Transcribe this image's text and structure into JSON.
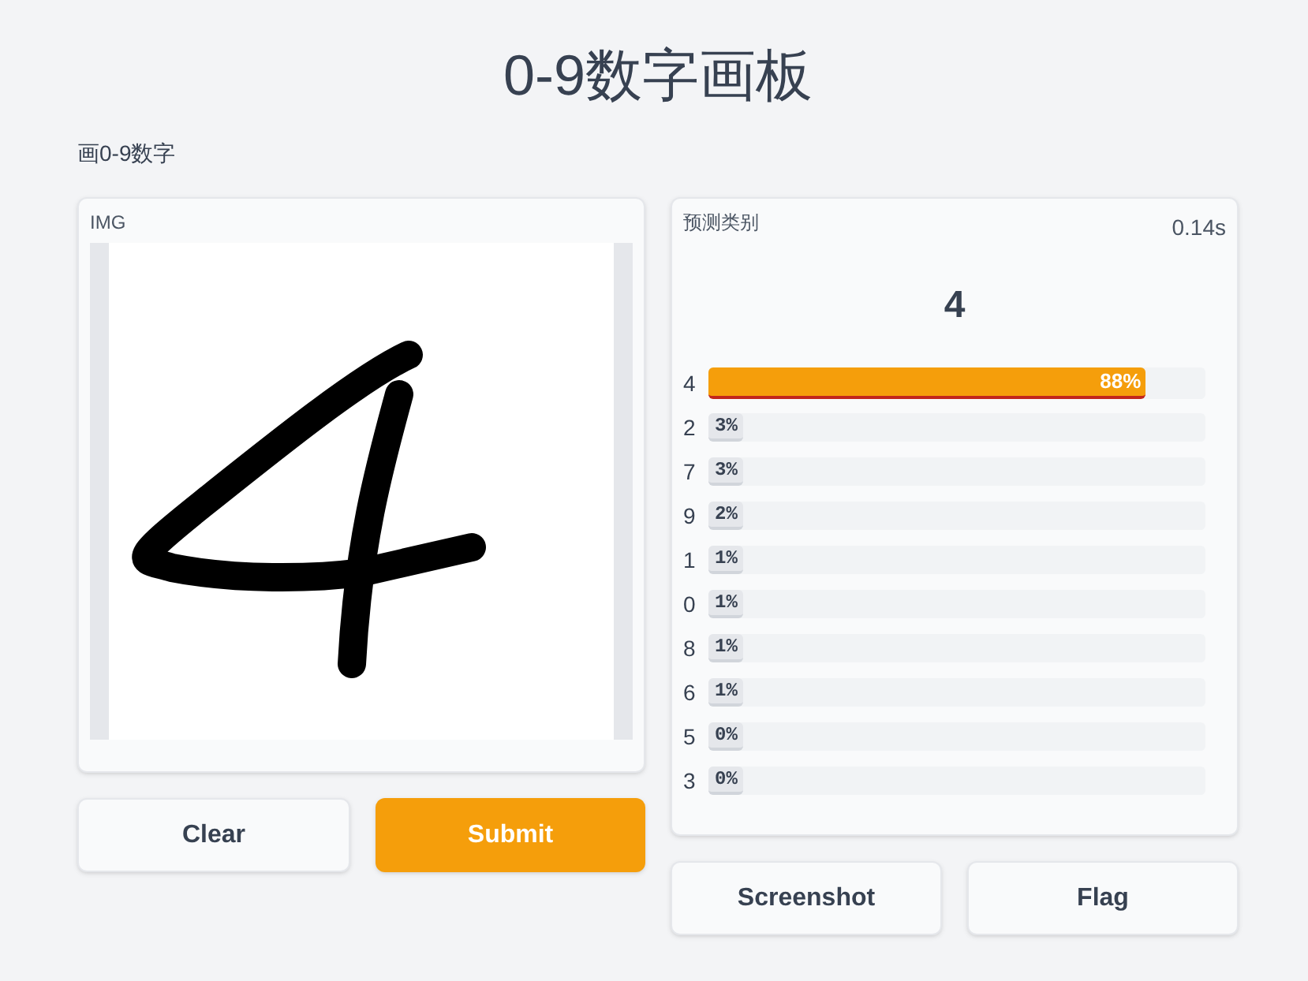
{
  "title": "0-9数字画板",
  "description": "画0-9数字",
  "input_panel": {
    "label": "IMG"
  },
  "input_buttons": [
    {
      "label": "Clear",
      "kind": "secondary"
    },
    {
      "label": "Submit",
      "kind": "primary"
    }
  ],
  "output_panel": {
    "label": "预测类别",
    "elapsed": "0.14s",
    "predicted": "4",
    "predictions": [
      {
        "class": "4",
        "level": 0.88,
        "reading": "88%",
        "selected": true
      },
      {
        "class": "2",
        "level": 0.03,
        "reading": "3%",
        "selected": false
      },
      {
        "class": "7",
        "level": 0.03,
        "reading": "3%",
        "selected": false
      },
      {
        "class": "9",
        "level": 0.02,
        "reading": "2%",
        "selected": false
      },
      {
        "class": "1",
        "level": 0.01,
        "reading": "1%",
        "selected": false
      },
      {
        "class": "0",
        "level": 0.01,
        "reading": "1%",
        "selected": false
      },
      {
        "class": "8",
        "level": 0.01,
        "reading": "1%",
        "selected": false
      },
      {
        "class": "6",
        "level": 0.01,
        "reading": "1%",
        "selected": false
      },
      {
        "class": "5",
        "level": 0.0,
        "reading": "0%",
        "selected": false
      },
      {
        "class": "3",
        "level": 0.0,
        "reading": "0%",
        "selected": false
      }
    ]
  },
  "output_buttons": [
    {
      "label": "Screenshot",
      "kind": "secondary"
    },
    {
      "label": "Flag",
      "kind": "secondary"
    }
  ]
}
